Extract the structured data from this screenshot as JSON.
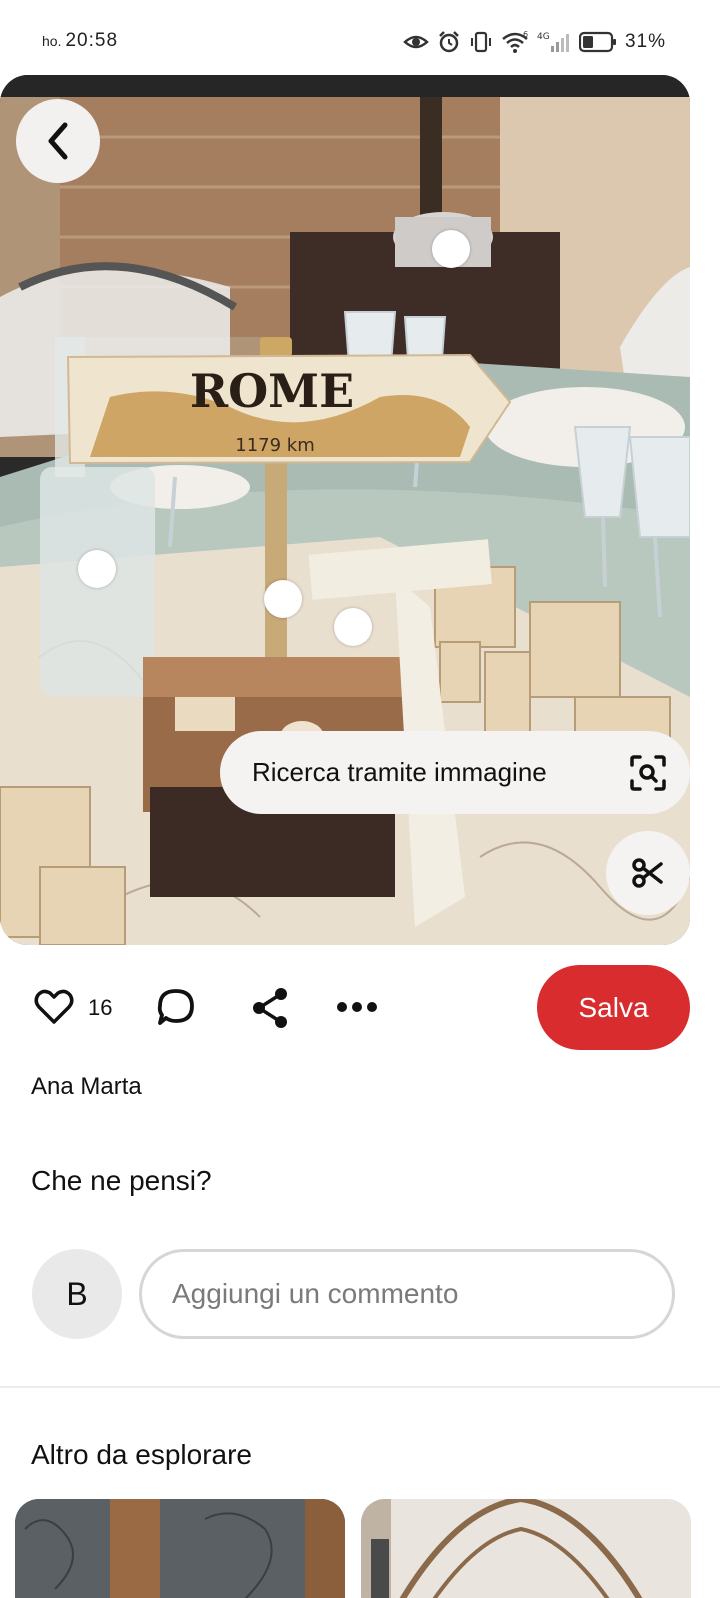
{
  "status_bar": {
    "carrier": "ho.",
    "time": "20:58",
    "network": "4G",
    "signal_superscript": "6",
    "battery_percent": "31%"
  },
  "pin": {
    "image_sign_text": "ROME",
    "image_sign_distance": "1179 km",
    "visual_search_label": "Ricerca tramite immagine"
  },
  "actions": {
    "like_count": "16",
    "save_label": "Salva"
  },
  "author": {
    "name": "Ana Marta"
  },
  "comments": {
    "heading": "Che ne pensi?",
    "avatar_initial": "B",
    "input_placeholder": "Aggiungi un commento"
  },
  "explore": {
    "heading": "Altro da esplorare"
  },
  "colors": {
    "save_button": "#d92c2e",
    "icon": "#111111"
  }
}
